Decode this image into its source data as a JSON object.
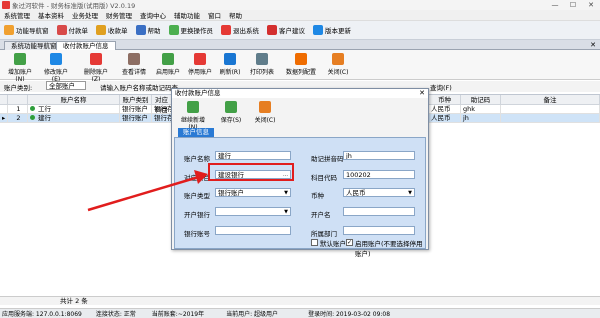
{
  "window": {
    "title": "象过河软件 - 财务标准版(试用版) V2.0.19"
  },
  "menu": [
    "系统管理",
    "基本资料",
    "业务处理",
    "财务管理",
    "查询中心",
    "辅助功能",
    "窗口",
    "帮助"
  ],
  "toolbar": [
    "功能导航窗",
    "付款单",
    "收款单",
    "帮助",
    "更换操作员",
    "退出系统",
    "客户建议",
    "版本更新"
  ],
  "tabs": [
    "系统功能导航窗",
    "收付款账户信息"
  ],
  "ribbon": [
    "增加账户(N)",
    "修改账户(E)",
    "删除账户(Z)",
    "查看详情",
    "启用账户",
    "停用账户",
    "刷新(R)",
    "打印列表",
    "数据列配置",
    "关闭(C)"
  ],
  "filter": {
    "label": "账户类别:",
    "value": "全部账户",
    "hint": "请输入账户名称或助记码查",
    "btn": "查询(F)"
  },
  "grid": {
    "headers": [
      "",
      "",
      "账户名称",
      "账户类别",
      "对应科目",
      "币种",
      "助记码",
      "备注"
    ],
    "rows": [
      {
        "no": "1",
        "name": "工行",
        "type": "银行账户",
        "subject": "银行存",
        "currency": "人民币",
        "code": "ghk"
      },
      {
        "no": "2",
        "name": "建行",
        "type": "银行账户",
        "subject": "银行存",
        "currency": "人民币",
        "code": "jh"
      }
    ]
  },
  "summary": "共计 2 条",
  "status": {
    "server": "应用服务端: 127.0.0.1:8069",
    "conn": "连接状态: 正常",
    "account": "当前账套:~2019年",
    "user": "当前用户: 超级用户",
    "time": "登录时间: 2019-03-02 09:08"
  },
  "dialog": {
    "title": "收付款账户信息",
    "buttons": [
      "继续新增(N)",
      "保存(S)",
      "关闭(C)"
    ],
    "tab": "账户信息",
    "fields": {
      "name_label": "账户名称",
      "name_value": "建行",
      "mnemonic_label": "助记拼音码",
      "mnemonic_value": "jh",
      "subject_label": "对应科目",
      "subject_value": "建设银行",
      "code_label": "科目代码",
      "code_value": "100202",
      "type_label": "账户类型",
      "type_value": "银行账户",
      "currency_label": "币种",
      "currency_value": "人民币",
      "bank_label": "开户银行",
      "acct_name_label": "开户名",
      "acct_no_label": "银行账号",
      "dept_label": "所属部门",
      "default_label": "默认账户",
      "enabled_label": "启用账户(不要选择停用账户)"
    }
  },
  "colors": {
    "highlight": "#e11d1d",
    "dialog_body": "#cfe0f5",
    "tab_blue": "#2a7ad4"
  }
}
